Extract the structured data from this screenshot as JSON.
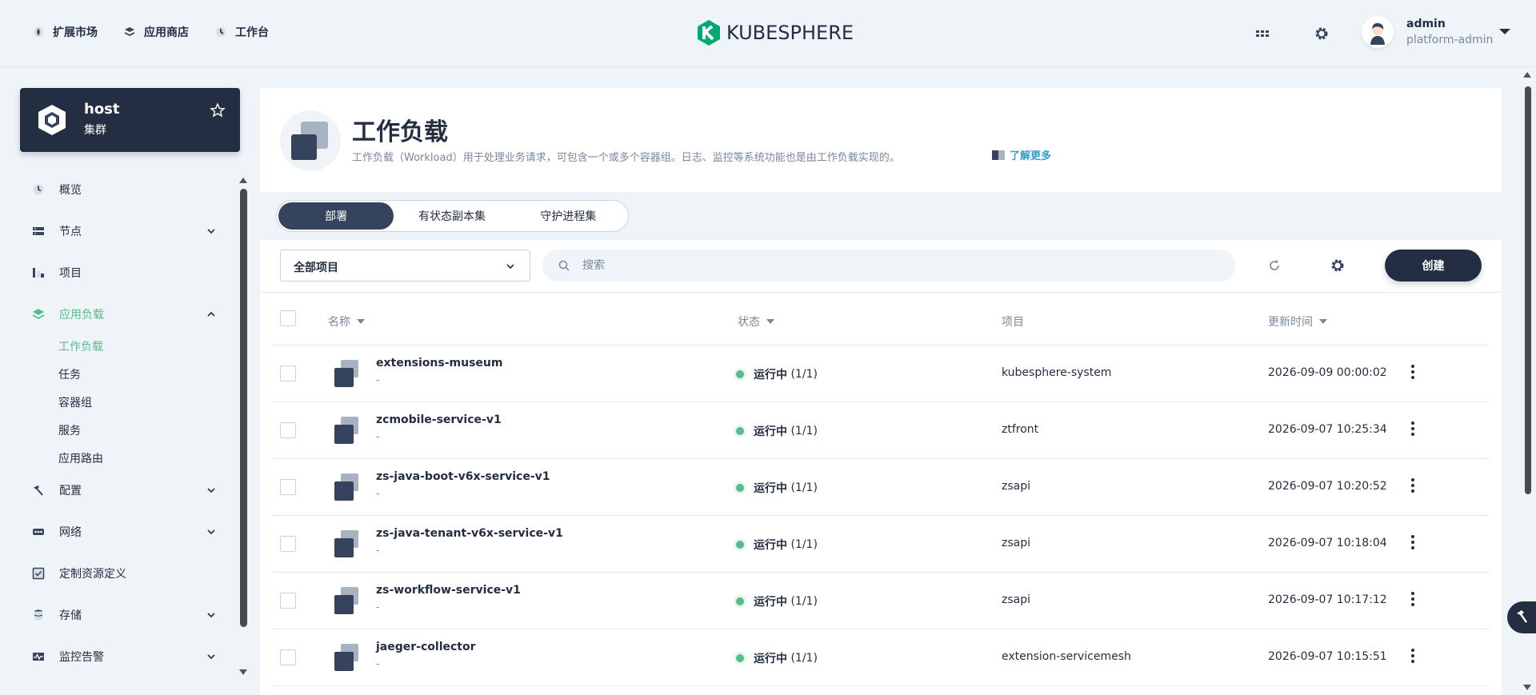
{
  "header": {
    "nav": [
      {
        "label": "扩展市场",
        "icon": "puzzle-icon"
      },
      {
        "label": "应用商店",
        "icon": "app-store-icon"
      },
      {
        "label": "工作台",
        "icon": "dashboard-icon"
      }
    ],
    "logo_text": "KUBESPHERE",
    "user": {
      "name": "admin",
      "role": "platform-admin"
    }
  },
  "cluster": {
    "name": "host",
    "type": "集群"
  },
  "sidebar": {
    "items": [
      {
        "label": "概览",
        "icon": "overview-icon"
      },
      {
        "label": "节点",
        "icon": "node-icon"
      },
      {
        "label": "项目",
        "icon": "project-icon"
      },
      {
        "label": "应用负载",
        "icon": "app-workload-icon"
      },
      {
        "label": "配置",
        "icon": "hammer-icon"
      },
      {
        "label": "网络",
        "icon": "network-icon"
      },
      {
        "label": "定制资源定义",
        "icon": "crd-icon"
      },
      {
        "label": "存储",
        "icon": "storage-icon"
      },
      {
        "label": "监控告警",
        "icon": "monitoring-icon"
      }
    ],
    "subitems": [
      "工作负载",
      "任务",
      "容器组",
      "服务",
      "应用路由"
    ],
    "active_sub": "工作负载"
  },
  "banner": {
    "title": "工作负载",
    "description": "工作负载（Workload）用于处理业务请求，可包含一个或多个容器组。日志、监控等系统功能也是由工作负载实现的。",
    "learn_more": "了解更多"
  },
  "tabs": [
    "部署",
    "有状态副本集",
    "守护进程集"
  ],
  "toolbar": {
    "project_select": "全部项目",
    "search_placeholder": "搜索",
    "create_label": "创建"
  },
  "table": {
    "columns": {
      "name": "名称",
      "status": "状态",
      "project": "项目",
      "updated": "更新时间"
    },
    "rows": [
      {
        "name": "extensions-museum",
        "sub": "-",
        "status": "运行中",
        "count": "(1/1)",
        "project": "kubesphere-system",
        "updated": "2026-09-09 00:00:02"
      },
      {
        "name": "zcmobile-service-v1",
        "sub": "-",
        "status": "运行中",
        "count": "(1/1)",
        "project": "ztfront",
        "updated": "2026-09-07 10:25:34"
      },
      {
        "name": "zs-java-boot-v6x-service-v1",
        "sub": "-",
        "status": "运行中",
        "count": "(1/1)",
        "project": "zsapi",
        "updated": "2026-09-07 10:20:52"
      },
      {
        "name": "zs-java-tenant-v6x-service-v1",
        "sub": "-",
        "status": "运行中",
        "count": "(1/1)",
        "project": "zsapi",
        "updated": "2026-09-07 10:18:04"
      },
      {
        "name": "zs-workflow-service-v1",
        "sub": "-",
        "status": "运行中",
        "count": "(1/1)",
        "project": "zsapi",
        "updated": "2026-09-07 10:17:12"
      },
      {
        "name": "jaeger-collector",
        "sub": "-",
        "status": "运行中",
        "count": "(1/1)",
        "project": "extension-servicemesh",
        "updated": "2026-09-07 10:15:51"
      }
    ]
  },
  "colors": {
    "accent": "#55bc8a",
    "dark": "#242e42",
    "muted": "#79879c"
  }
}
